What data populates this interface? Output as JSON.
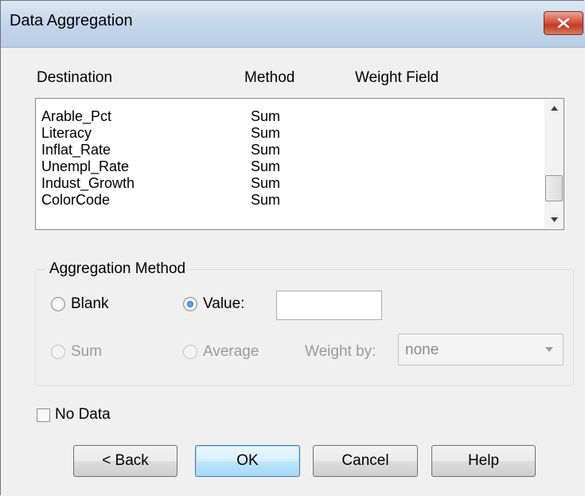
{
  "window": {
    "title": "Data Aggregation"
  },
  "columns": {
    "destination": "Destination",
    "method": "Method",
    "weight": "Weight Field"
  },
  "fields": [
    {
      "destination": "Arable_Pct",
      "method": "Sum",
      "weight": ""
    },
    {
      "destination": "Literacy",
      "method": "Sum",
      "weight": ""
    },
    {
      "destination": "Inflat_Rate",
      "method": "Sum",
      "weight": ""
    },
    {
      "destination": "Unempl_Rate",
      "method": "Sum",
      "weight": ""
    },
    {
      "destination": "Indust_Growth",
      "method": "Sum",
      "weight": ""
    },
    {
      "destination": "ColorCode",
      "method": "Sum",
      "weight": ""
    }
  ],
  "aggregation": {
    "legend": "Aggregation Method",
    "blank_label": "Blank",
    "value_label": "Value:",
    "value_input": "",
    "sum_label": "Sum",
    "average_label": "Average",
    "weight_by_label": "Weight by:",
    "weight_by_value": "none",
    "selected": "value"
  },
  "no_data_label": "No Data",
  "no_data_checked": false,
  "buttons": {
    "back": "< Back",
    "ok": "OK",
    "cancel": "Cancel",
    "help": "Help"
  },
  "colors": {
    "close_button": "#c43a22",
    "radio_selected": "#1b5fb5",
    "disabled_text": "#9a9a9a"
  }
}
